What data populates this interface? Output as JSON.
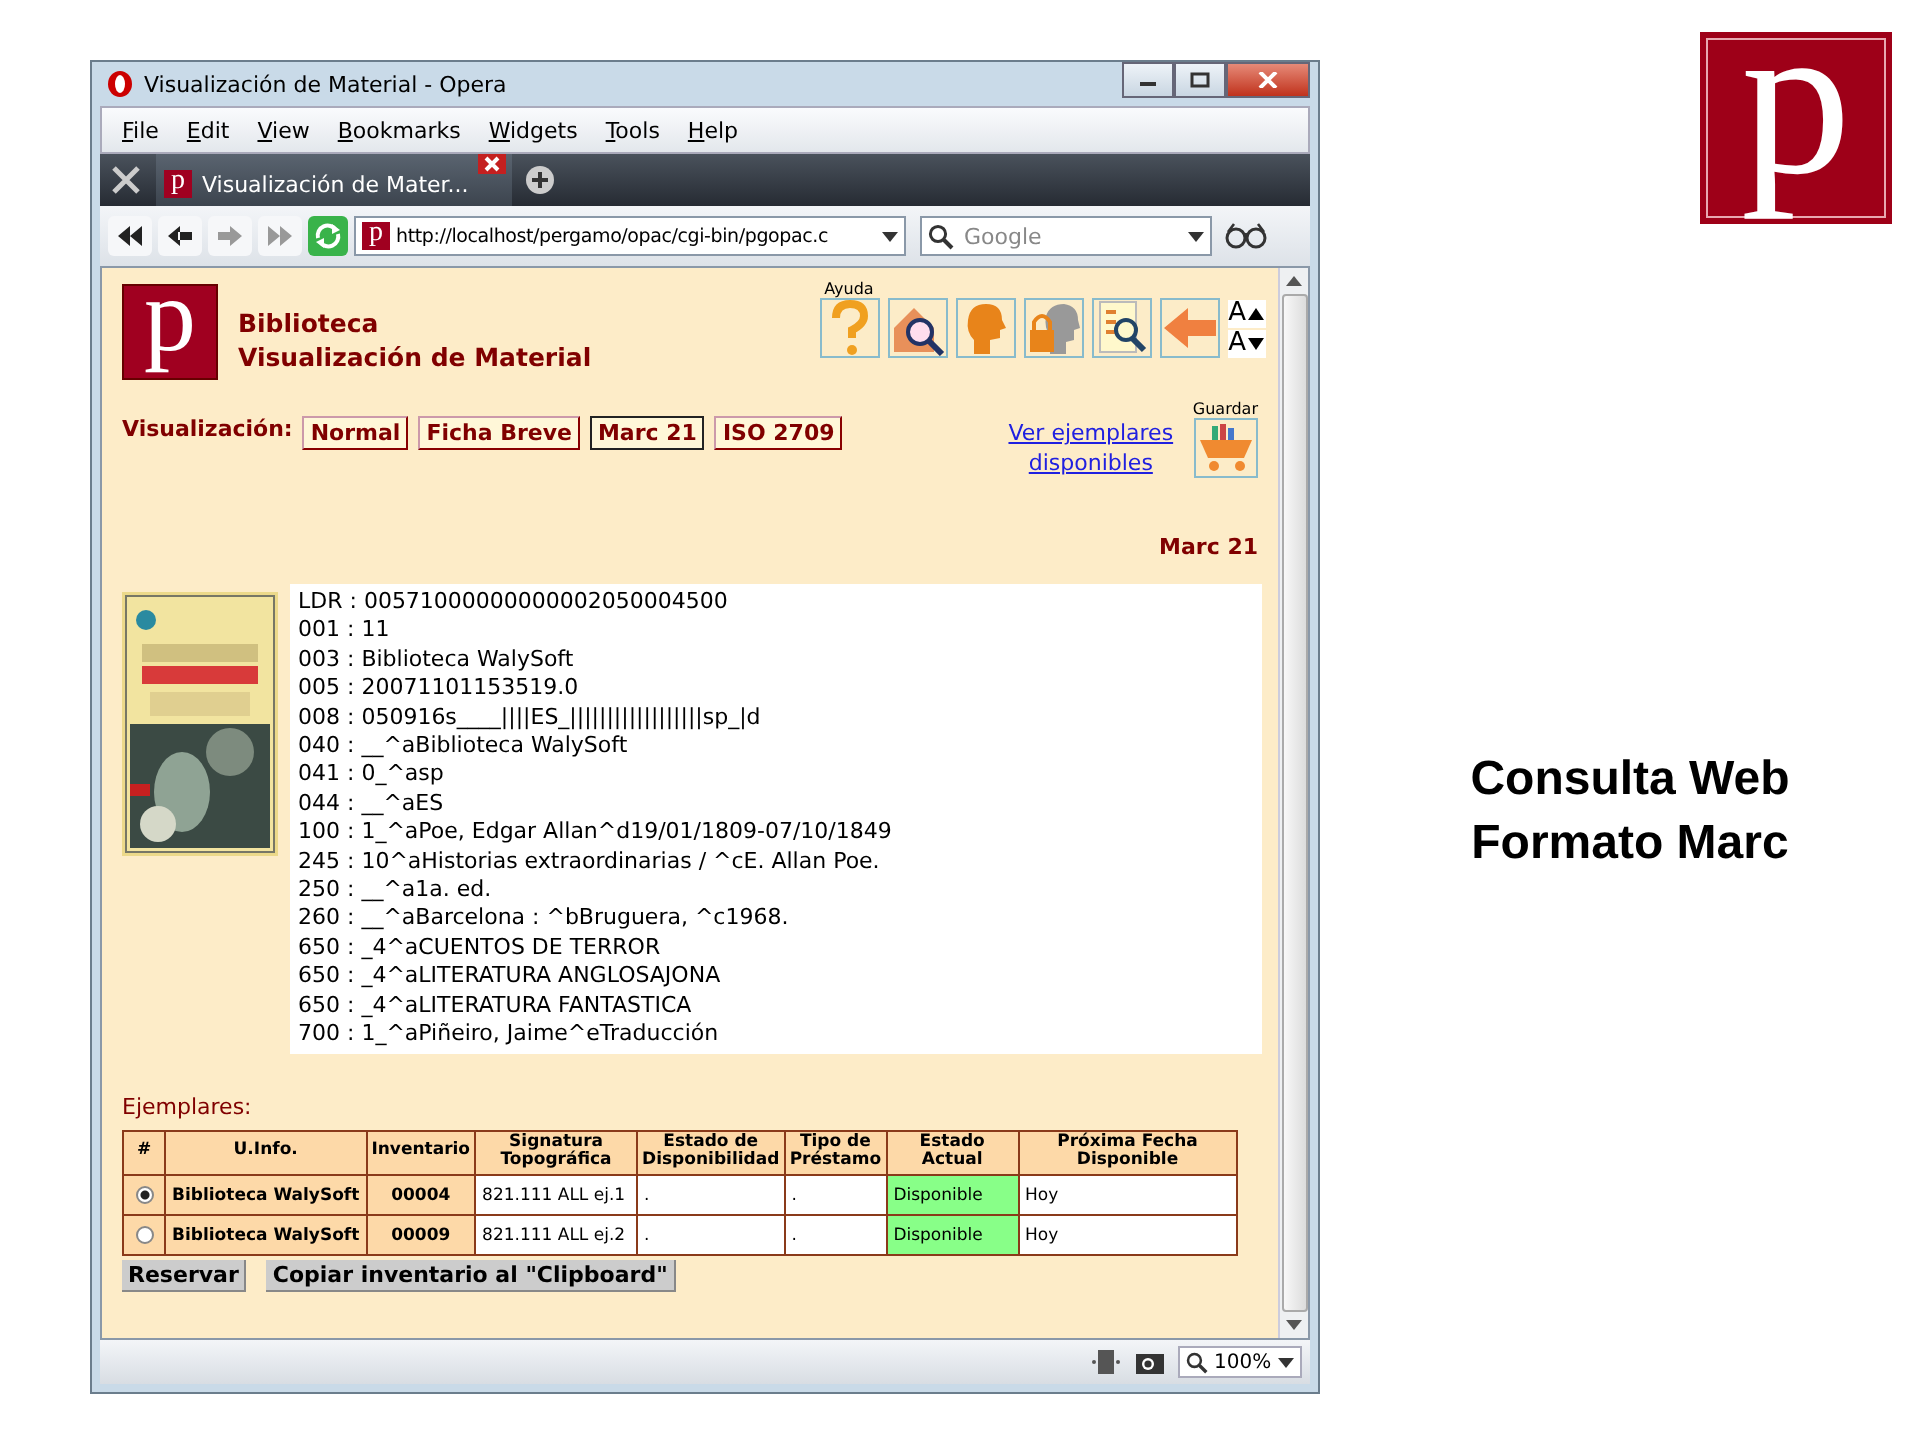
{
  "slide": {
    "logo_letter": "p",
    "caption_lines": [
      "Consulta Web",
      "Formato Marc"
    ]
  },
  "window": {
    "title": "Visualización de Material - Opera"
  },
  "menu": [
    "File",
    "Edit",
    "View",
    "Bookmarks",
    "Widgets",
    "Tools",
    "Help"
  ],
  "tabs": [
    {
      "favicon_letter": "p",
      "label": "Visualización de Mater...",
      "selected": true
    }
  ],
  "address_bar": {
    "favicon_letter": "p",
    "url": "http://localhost/pergamo/opac/cgi-bin/pgopac.c",
    "search_placeholder": "Google"
  },
  "page": {
    "logo_letter": "p",
    "title_lines": [
      "Biblioteca",
      "Visualización de Material"
    ],
    "help_label": "Ayuda",
    "font_buttons": [
      "A",
      "A"
    ],
    "view_label": "Visualización:",
    "view_tabs": [
      {
        "label": "Normal",
        "selected": false
      },
      {
        "label": "Ficha Breve",
        "selected": false
      },
      {
        "label": "Marc 21",
        "selected": true
      },
      {
        "label": "ISO 2709",
        "selected": false
      }
    ],
    "link": "Ver ejemplares disponibles",
    "save_label": "Guardar",
    "format_heading": "Marc 21",
    "marc_lines": [
      "LDR : 00571000000000002050004500",
      "001 : 11",
      "003 : Biblioteca WalySoft",
      "005 : 20071101153519.0",
      "008 : 050916s____||||ES_||||||||||||||||||sp_|d",
      "040 : __^aBiblioteca WalySoft",
      "041 : 0_^asp",
      "044 : __^aES",
      "100 : 1_^aPoe, Edgar Allan^d19/01/1809-07/10/1849",
      "245 : 10^aHistorias extraordinarias / ^cE. Allan Poe.",
      "250 : __^a1a. ed.",
      "260 : __^aBarcelona : ^bBruguera, ^c1968.",
      "650 : _4^aCUENTOS DE TERROR",
      "650 : _4^aLITERATURA ANGLOSAJONA",
      "650 : _4^aLITERATURA FANTASTICA",
      "700 : 1_^aPiñeiro, Jaime^eTraducción"
    ],
    "copies_heading": "Ejemplares:",
    "table": {
      "columns": [
        "#",
        "U.Info.",
        "Inventario",
        "Signatura Topográfica",
        "Estado de Disponibilidad",
        "Tipo de Préstamo",
        "Estado Actual",
        "Próxima Fecha Disponible"
      ],
      "rows": [
        {
          "selected": true,
          "cells": [
            "",
            "Biblioteca WalySoft",
            "00004",
            "821.111 ALL ej.1",
            ".",
            ".",
            "Disponible",
            "Hoy"
          ]
        },
        {
          "selected": false,
          "cells": [
            "",
            "Biblioteca WalySoft",
            "00009",
            "821.111 ALL ej.2",
            ".",
            ".",
            "Disponible",
            "Hoy"
          ]
        }
      ]
    },
    "buttons": [
      "Reservar",
      "Copiar inventario al \"Clipboard\""
    ]
  },
  "status_bar": {
    "zoom": "100%"
  }
}
